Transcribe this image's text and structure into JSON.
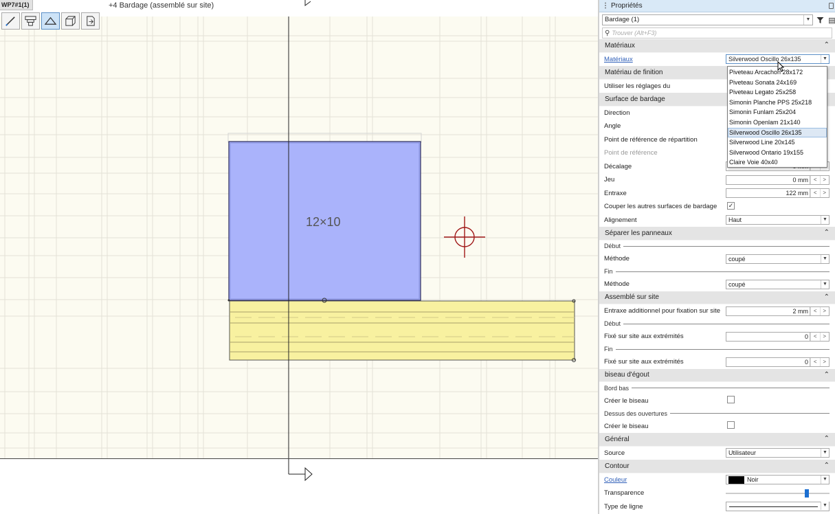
{
  "viewport": {
    "tab_label": "WP7#1(1)",
    "title": "+4 Bardage (assemblé sur site)",
    "panel_label": "12×10",
    "toolbar": [
      {
        "name": "pencil-icon"
      },
      {
        "name": "structure-icon"
      },
      {
        "name": "roof-icon",
        "active": true
      },
      {
        "name": "box-3d-icon"
      },
      {
        "name": "export-icon"
      }
    ]
  },
  "panel": {
    "header": "Propriétés",
    "selection": "Bardage (1)",
    "search_placeholder": "Trouver (Alt+F3)",
    "materials_dropdown": {
      "options": [
        "Piveteau Arcachon 28x172",
        "Piveteau Sonata 24x169",
        "Piveteau Legato 25x258",
        "Simonin Planche PPS 25x218",
        "Simonin Funlam 25x204",
        "Simonin Openlam 21x140",
        "Silverwood Oscillo 26x135",
        "Silverwood Line 20x145",
        "Silverwood Ontario 19x155",
        "Claire Voie 40x40"
      ],
      "selected": "Silverwood Oscillo 26x135"
    },
    "sections": {
      "materiaux": "Matériaux",
      "materiaux_label": "Matériaux",
      "materiaux_value": "Silverwood Oscillo 26x135",
      "materiau_finition": "Matériau de finition",
      "utiliser_reglages": "Utiliser les réglages du",
      "surface_bardage": "Surface de bardage",
      "direction": "Direction",
      "angle": "Angle",
      "point_ref_repartition": "Point de référence de répartition",
      "point_ref": "Point de référence",
      "decalage": "Décalage",
      "decalage_value": "0 mm",
      "jeu": "Jeu",
      "jeu_value": "0 mm",
      "entraxe": "Entraxe",
      "entraxe_value": "122 mm",
      "couper": "Couper les autres surfaces de bardage",
      "couper_checked": "✓",
      "alignement": "Alignement",
      "alignement_value": "Haut",
      "separer": "Séparer les panneaux",
      "debut": "Début",
      "methode": "Méthode",
      "methode_debut_value": "coupé",
      "fin": "Fin",
      "methode_fin_value": "coupé",
      "assemble": "Assemblé sur site",
      "entraxe_add": "Entraxe additionnel pour fixation sur site",
      "entraxe_add_value": "2 mm",
      "debut2": "Début",
      "fixe1": "Fixé sur site aux extrémités",
      "fixe1_value": "0",
      "fin2": "Fin",
      "fixe2": "Fixé sur site aux extrémités",
      "fixe2_value": "0",
      "biseau": "biseau d'égout",
      "bord_bas": "Bord bas",
      "creer_biseau1": "Créer le biseau",
      "dessus_ouvertures": "Dessus des ouvertures",
      "creer_biseau2": "Créer le biseau",
      "general": "Général",
      "source": "Source",
      "source_value": "Utilisateur",
      "contour": "Contour",
      "couleur": "Couleur",
      "couleur_value": "Noir",
      "transparence": "Transparence",
      "transparence_level_pct": 78,
      "type_ligne": "Type de ligne"
    }
  },
  "colors": {
    "canvas_bg": "#fcfbf1",
    "panel_fill_blue": "#aab3fb",
    "bardage_fill_yellow": "#f8f1a0",
    "crosshair": "#a01818",
    "header_bg": "#d9e9f7",
    "section_bg": "#e4e4e4",
    "link": "#2f5fb8"
  }
}
